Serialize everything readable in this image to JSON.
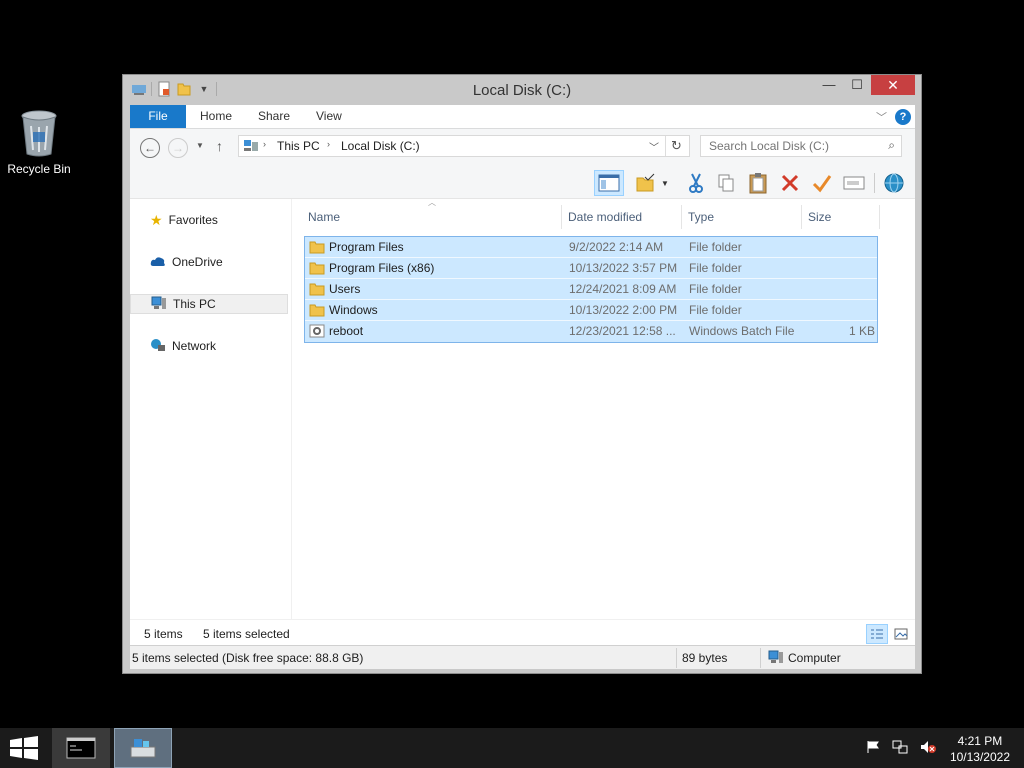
{
  "desktop": {
    "recycle_bin_label": "Recycle Bin"
  },
  "window": {
    "title": "Local Disk (C:)"
  },
  "ribbon": {
    "tabs": [
      "File",
      "Home",
      "Share",
      "View"
    ]
  },
  "address": {
    "crumbs": [
      "This PC",
      "Local Disk (C:)"
    ]
  },
  "search": {
    "placeholder": "Search Local Disk (C:)"
  },
  "navpane": {
    "items": [
      "Favorites",
      "OneDrive",
      "This PC",
      "Network"
    ],
    "selected": "This PC"
  },
  "columns": [
    "Name",
    "Date modified",
    "Type",
    "Size"
  ],
  "files": [
    {
      "name": "Program Files",
      "date": "9/2/2022 2:14 AM",
      "type": "File folder",
      "size": "",
      "icon": "folder-icon"
    },
    {
      "name": "Program Files (x86)",
      "date": "10/13/2022 3:57 PM",
      "type": "File folder",
      "size": "",
      "icon": "folder-icon"
    },
    {
      "name": "Users",
      "date": "12/24/2021 8:09 AM",
      "type": "File folder",
      "size": "",
      "icon": "folder-icon"
    },
    {
      "name": "Windows",
      "date": "10/13/2022 2:00 PM",
      "type": "File folder",
      "size": "",
      "icon": "folder-icon"
    },
    {
      "name": "reboot",
      "date": "12/23/2021 12:58 ...",
      "type": "Windows Batch File",
      "size": "1 KB",
      "icon": "batch-file-icon"
    }
  ],
  "status": {
    "item_count": "5 items",
    "selected_count": "5 items selected"
  },
  "details": {
    "summary": "5 items selected (Disk free space: 88.8 GB)",
    "bytes": "89 bytes",
    "location": "Computer"
  },
  "taskbar": {
    "time": "4:21 PM",
    "date": "10/13/2022"
  },
  "colors": {
    "accent": "#1979ca",
    "selection": "#cce8ff",
    "selection_border": "#7eb4ea",
    "close": "#c74041"
  }
}
